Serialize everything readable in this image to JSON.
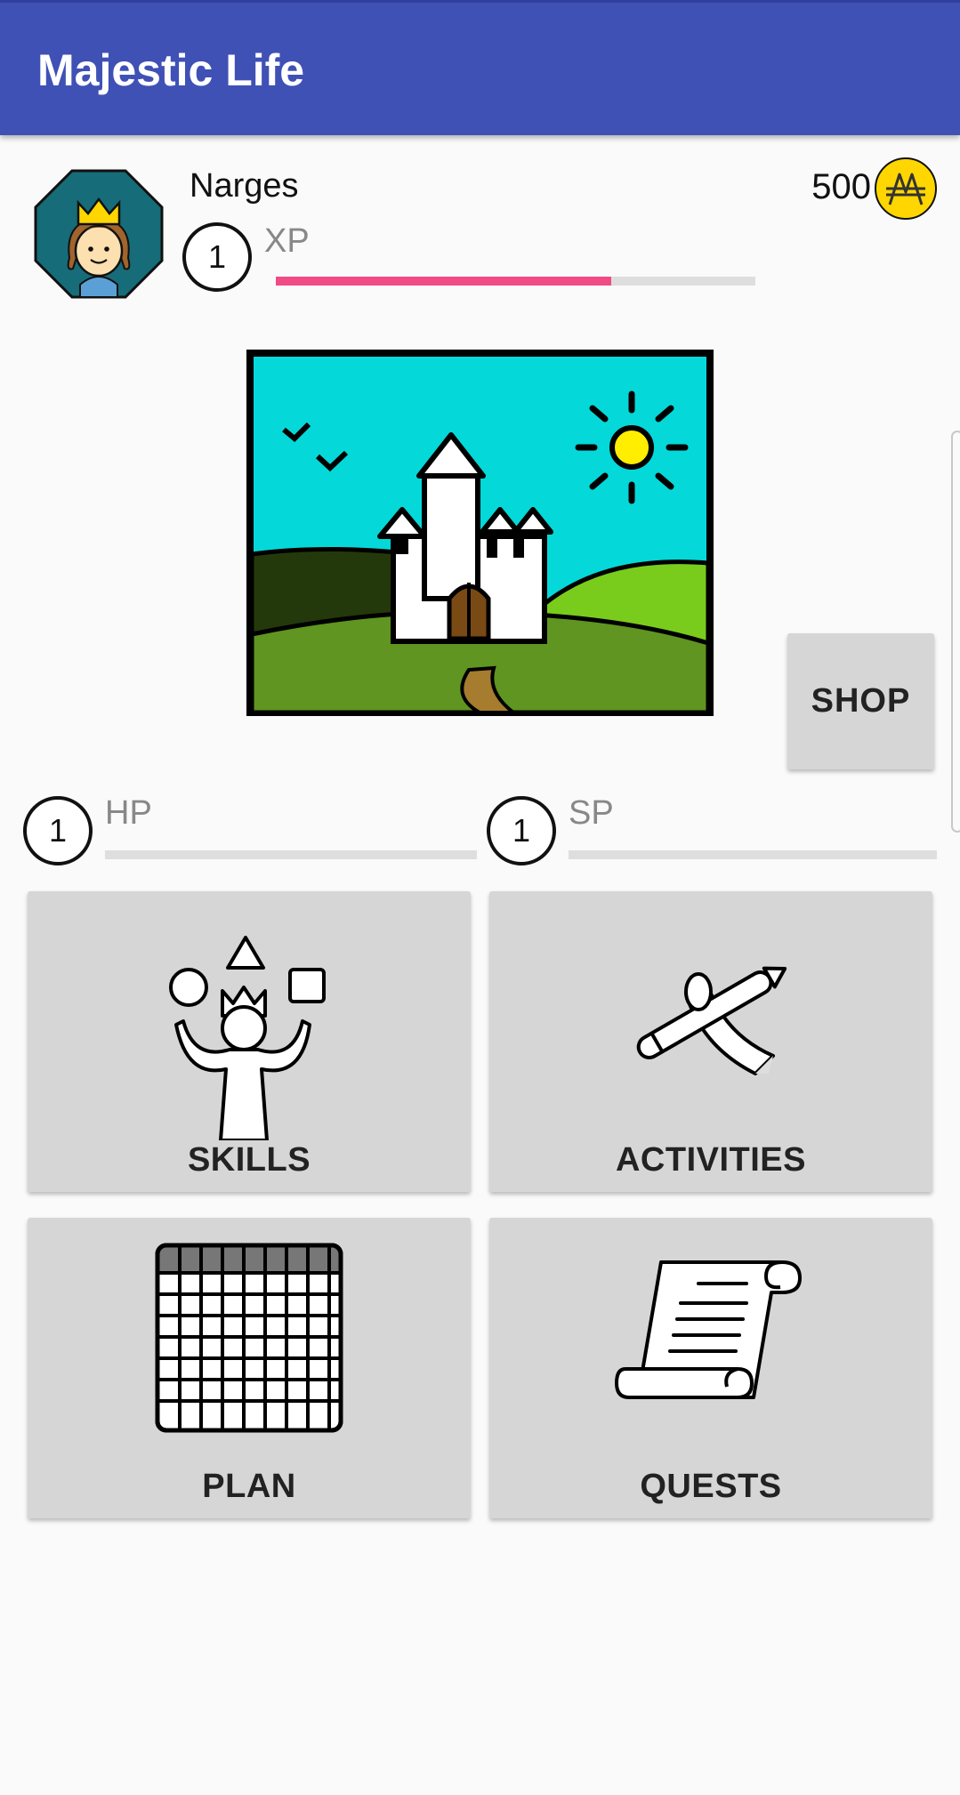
{
  "appbar": {
    "title": "Majestic Life"
  },
  "profile": {
    "name": "Narges",
    "coins": "500",
    "avatar_icon": "princess-avatar-icon",
    "coin_icon": "coin-icon"
  },
  "stats": {
    "xp": {
      "label": "XP",
      "level": "1",
      "progress": 0.7
    },
    "hp": {
      "label": "HP",
      "level": "1",
      "progress": 0
    },
    "sp": {
      "label": "SP",
      "level": "1",
      "progress": 0
    }
  },
  "scene": {
    "icon": "castle-landscape-image"
  },
  "shop": {
    "label": "SHOP"
  },
  "tiles": [
    {
      "label": "SKILLS",
      "icon": "juggling-king-icon"
    },
    {
      "label": "ACTIVITIES",
      "icon": "pencil-icon"
    },
    {
      "label": "PLAN",
      "icon": "calendar-grid-icon"
    },
    {
      "label": "QUESTS",
      "icon": "scroll-icon"
    }
  ],
  "colors": {
    "appbar": "#3f51b5",
    "xp_bar": "#f04b84",
    "tile_bg": "#d6d6d6",
    "coin": "#ffd600"
  }
}
